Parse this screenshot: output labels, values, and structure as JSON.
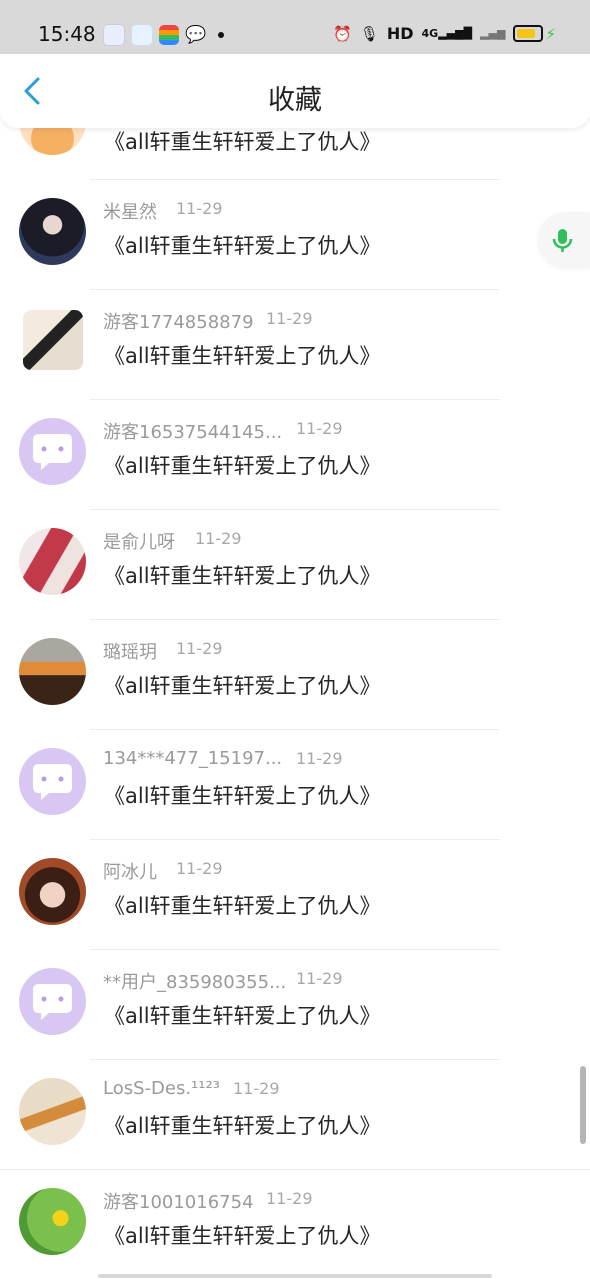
{
  "status_bar": {
    "time": "15:48",
    "hd": "HD",
    "network": "4G"
  },
  "header": {
    "title": "收藏"
  },
  "items": [
    {
      "name": "",
      "date": "",
      "text": "《all轩重生轩轩爱上了仇人》"
    },
    {
      "name": "米星然",
      "date": "11-29",
      "text": "《all轩重生轩轩爱上了仇人》"
    },
    {
      "name": "游客1774858879",
      "date": "11-29",
      "text": "《all轩重生轩轩爱上了仇人》"
    },
    {
      "name": "游客16537544145...",
      "date": "11-29",
      "text": "《all轩重生轩轩爱上了仇人》"
    },
    {
      "name": "是俞儿呀",
      "date": "11-29",
      "text": "《all轩重生轩轩爱上了仇人》"
    },
    {
      "name": "璐瑶玥",
      "date": "11-29",
      "text": "《all轩重生轩轩爱上了仇人》"
    },
    {
      "name": "134***477_15197...",
      "date": "11-29",
      "text": "《all轩重生轩轩爱上了仇人》"
    },
    {
      "name": "阿冰儿",
      "date": "11-29",
      "text": "《all轩重生轩轩爱上了仇人》"
    },
    {
      "name": "**用户_835980355...",
      "date": "11-29",
      "text": "《all轩重生轩轩爱上了仇人》"
    },
    {
      "name": "LosS-Des.¹¹²³",
      "date": "11-29",
      "text": "《all轩重生轩轩爱上了仇人》"
    },
    {
      "name": "游客1001016754",
      "date": "11-29",
      "text": "《all轩重生轩轩爱上了仇人》"
    }
  ],
  "colors": {
    "accent": "#2b9bdc",
    "mic": "#2fbf5a",
    "default_avatar": "#d9c7f3"
  }
}
